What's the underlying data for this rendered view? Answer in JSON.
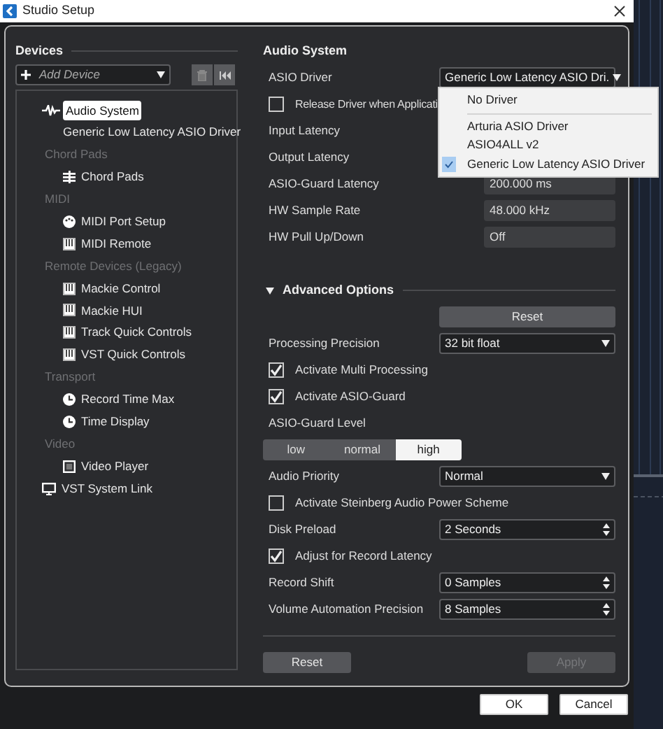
{
  "window": {
    "title": "Studio Setup"
  },
  "devices": {
    "title": "Devices",
    "add_device": "Add Device",
    "tree": [
      {
        "kind": "item",
        "label": "Audio System",
        "selected": true,
        "children": [
          {
            "kind": "item",
            "label": "Generic Low Latency ASIO Driver",
            "selected": false
          }
        ]
      },
      {
        "kind": "category",
        "label": "Chord Pads",
        "children": [
          {
            "kind": "item",
            "label": "Chord Pads",
            "selected": false
          }
        ]
      },
      {
        "kind": "category",
        "label": "MIDI",
        "children": [
          {
            "kind": "item",
            "label": "MIDI Port Setup",
            "selected": false
          },
          {
            "kind": "item",
            "label": "MIDI Remote",
            "selected": false
          }
        ]
      },
      {
        "kind": "category",
        "label": "Remote Devices (Legacy)",
        "children": [
          {
            "kind": "item",
            "label": "Mackie Control",
            "selected": false
          },
          {
            "kind": "item",
            "label": "Mackie HUI",
            "selected": false
          },
          {
            "kind": "item",
            "label": "Track Quick Controls",
            "selected": false
          },
          {
            "kind": "item",
            "label": "VST Quick Controls",
            "selected": false
          }
        ]
      },
      {
        "kind": "category",
        "label": "Transport",
        "children": [
          {
            "kind": "item",
            "label": "Record Time Max",
            "selected": false
          },
          {
            "kind": "item",
            "label": "Time Display",
            "selected": false
          }
        ]
      },
      {
        "kind": "category",
        "label": "Video",
        "children": [
          {
            "kind": "item",
            "label": "Video Player",
            "selected": false
          }
        ]
      },
      {
        "kind": "item",
        "label": "VST System Link",
        "selected": false
      }
    ]
  },
  "audio_system": {
    "title": "Audio System",
    "rows": [
      {
        "kind": "select",
        "label": "ASIO Driver",
        "value": "Generic Low Latency ASIO Dri."
      },
      {
        "kind": "check",
        "label": "Release Driver when Applicati",
        "checked": false
      },
      {
        "kind": "label",
        "label": "Input Latency"
      },
      {
        "kind": "label",
        "label": "Output Latency"
      },
      {
        "kind": "readout",
        "label": "ASIO-Guard Latency",
        "value": "200.000 ms"
      },
      {
        "kind": "readout",
        "label": "HW Sample Rate",
        "value": "48.000 kHz"
      },
      {
        "kind": "readout",
        "label": "HW Pull Up/Down",
        "value": "Off"
      }
    ]
  },
  "driver_menu": [
    {
      "label": "No Driver",
      "selected": false,
      "separator_after": true
    },
    {
      "label": "Arturia ASIO Driver",
      "selected": false,
      "separator_after": false
    },
    {
      "label": "ASIO4ALL v2",
      "selected": false,
      "separator_after": false
    },
    {
      "label": "Generic Low Latency ASIO Driver",
      "selected": true,
      "separator_after": false
    }
  ],
  "advanced": {
    "title": "Advanced Options",
    "expanded": true,
    "reset": "Reset",
    "rows": [
      {
        "kind": "select",
        "label": "Processing Precision",
        "value": "32 bit float"
      },
      {
        "kind": "check",
        "label": "Activate Multi Processing",
        "checked": true
      },
      {
        "kind": "check",
        "label": "Activate ASIO-Guard",
        "checked": true
      },
      {
        "kind": "label",
        "label": "ASIO-Guard Level"
      },
      {
        "kind": "segments",
        "options": [
          {
            "label": "low",
            "selected": false
          },
          {
            "label": "normal",
            "selected": false
          },
          {
            "label": "high",
            "selected": true
          }
        ]
      },
      {
        "kind": "select",
        "label": "Audio Priority",
        "value": "Normal"
      },
      {
        "kind": "check",
        "label": "Activate Steinberg Audio Power Scheme",
        "checked": false
      },
      {
        "kind": "spin",
        "label": "Disk Preload",
        "value": "2 Seconds"
      },
      {
        "kind": "check",
        "label": "Adjust for Record Latency",
        "checked": true
      },
      {
        "kind": "spin",
        "label": "Record Shift",
        "value": "0 Samples"
      },
      {
        "kind": "spin",
        "label": "Volume Automation Precision",
        "value": "8 Samples"
      }
    ]
  },
  "panel_buttons": [
    {
      "label": "Reset",
      "disabled": false
    },
    {
      "label": "Apply",
      "disabled": true
    }
  ],
  "dialog_buttons": [
    {
      "label": "OK"
    },
    {
      "label": "Cancel"
    }
  ]
}
